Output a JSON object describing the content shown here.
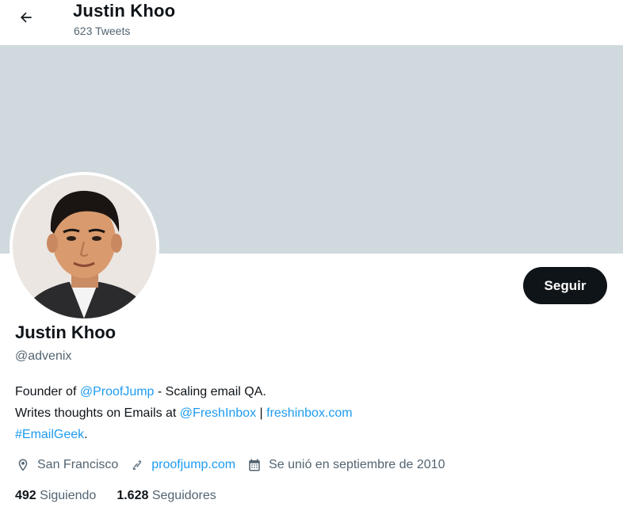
{
  "header": {
    "title": "Justin Khoo",
    "tweet_count": "623 Tweets",
    "back_icon": "arrow-left-icon"
  },
  "profile": {
    "name": "Justin Khoo",
    "handle": "@advenix",
    "follow_label": "Seguir"
  },
  "bio": {
    "line1_prefix": "Founder of ",
    "line1_link": "@ProofJump",
    "line1_suffix": " - Scaling email QA.",
    "line2_prefix": "Writes thoughts on Emails at ",
    "line2_link1": "@FreshInbox",
    "line2_sep": " | ",
    "line2_link2": "freshinbox.com",
    "line3_hashtag": "#EmailGeek",
    "line3_suffix": "."
  },
  "meta": {
    "location": "San Francisco",
    "website": "proofjump.com",
    "joined": "Se unió en septiembre de 2010"
  },
  "stats": {
    "following_count": "492",
    "following_label": "Siguiendo",
    "followers_count": "1.628",
    "followers_label": "Seguidores"
  },
  "colors": {
    "banner": "#cfd9de",
    "link": "#1d9bf0",
    "button_bg": "#0f1419",
    "secondary_text": "#536471"
  }
}
